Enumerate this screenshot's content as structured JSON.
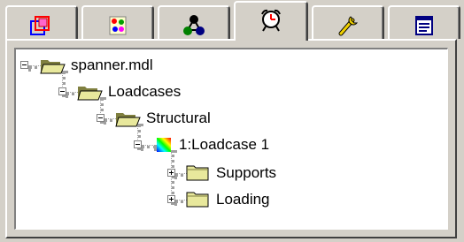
{
  "tabs": [
    {
      "name": "tab-geometry",
      "icon": "overlapping-squares-icon",
      "active": false
    },
    {
      "name": "tab-materials",
      "icon": "colored-dots-icon",
      "active": false
    },
    {
      "name": "tab-groups",
      "icon": "linked-nodes-icon",
      "active": false
    },
    {
      "name": "tab-analysis",
      "icon": "alarm-clock-icon",
      "active": true
    },
    {
      "name": "tab-tools",
      "icon": "wrench-icon",
      "active": false
    },
    {
      "name": "tab-properties",
      "icon": "form-window-icon",
      "active": false
    }
  ],
  "tree": {
    "root": {
      "label": "spanner.mdl",
      "icon": "open-folder-icon",
      "expanded": true
    },
    "loadcases": {
      "label": "Loadcases",
      "icon": "open-folder-icon",
      "expanded": true
    },
    "structural": {
      "label": "Structural",
      "icon": "open-folder-icon",
      "expanded": true
    },
    "loadcase1": {
      "label": "1:Loadcase 1",
      "icon": "rainbow-loadcase-icon",
      "expanded": true
    },
    "supports": {
      "label": "Supports",
      "icon": "closed-folder-icon",
      "expanded": false
    },
    "loading": {
      "label": "Loading",
      "icon": "closed-folder-icon",
      "expanded": false
    }
  },
  "colors": {
    "face": "#d4d0c8",
    "folder": "#e8e89c",
    "folder_dark": "#808040"
  }
}
